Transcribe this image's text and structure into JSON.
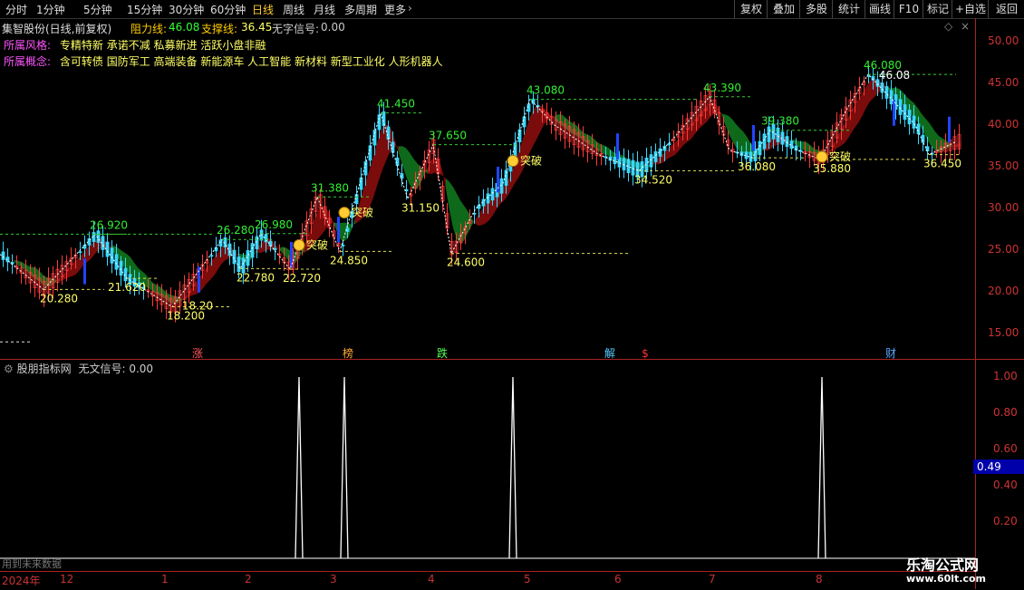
{
  "toolbar": {
    "timeframes": [
      "分时",
      "1分钟",
      "5分钟",
      "15分钟",
      "30分钟",
      "60分钟",
      "日线",
      "周线",
      "月线",
      "多周期",
      "更多"
    ],
    "active": "日线",
    "buttons": [
      "复权",
      "叠加",
      "多股",
      "统计",
      "画线",
      "F10",
      "标记",
      "+自选",
      "返回"
    ]
  },
  "header": {
    "stock": "集智股份(日线,前复权)",
    "resist_label": "阻力线:",
    "resist_value": "46.08",
    "support_label": "支撑线:",
    "support_value": "36.45",
    "signal_label": "无字信号:",
    "signal_value": "0.00"
  },
  "info": {
    "style_label": "所属风格:",
    "style_value": "专精特新 承诺不减 私募新进 活跃小盘非融",
    "concept_label": "所属概念:",
    "concept_value": "含可转债 国防军工 高端装备 新能源车 人工智能 新材料 新型工业化 人形机器人"
  },
  "main_axis": [
    "50.00",
    "45.00",
    "40.00",
    "35.00",
    "30.00",
    "25.00",
    "20.00",
    "15.00"
  ],
  "peaks": [
    {
      "label": "26.920"
    },
    {
      "label": "26.280"
    },
    {
      "label": "26.980"
    },
    {
      "label": "31.380"
    },
    {
      "label": "41.450"
    },
    {
      "label": "37.650"
    },
    {
      "label": "43.080"
    },
    {
      "label": "43.390"
    },
    {
      "label": "39.380"
    },
    {
      "label": "46.080"
    },
    {
      "label": "46.08"
    }
  ],
  "troughs": [
    {
      "label": "20.280"
    },
    {
      "label": "21.620"
    },
    {
      "label": "18.200"
    },
    {
      "label": "18.20"
    },
    {
      "label": "22.780"
    },
    {
      "label": "22.720"
    },
    {
      "label": "24.850"
    },
    {
      "label": "31.150"
    },
    {
      "label": "24.600"
    },
    {
      "label": "34.520"
    },
    {
      "label": "36.080"
    },
    {
      "label": "35.880"
    },
    {
      "label": "36.450"
    }
  ],
  "breakout_label": "突破",
  "bottom_marks": [
    {
      "text": "涨",
      "color": "#ff5555"
    },
    {
      "text": "榜",
      "color": "#ffaa33"
    },
    {
      "text": "跌",
      "color": "#55ff55"
    },
    {
      "text": "解",
      "color": "#55ccff"
    },
    {
      "text": "$",
      "color": "#ff3333"
    },
    {
      "text": "财",
      "color": "#55aaff"
    }
  ],
  "sub_panel": {
    "title": "股朋指标网",
    "signal_label": "无文信号:",
    "signal_value": "0.00",
    "axis": [
      "1.00",
      "0.80",
      "0.60",
      "0.40",
      "0.20"
    ],
    "current_value": "0.49",
    "note": "用到未来数据"
  },
  "date_axis": [
    "2024年",
    "12",
    "1",
    "2",
    "3",
    "4",
    "5",
    "6",
    "7",
    "8"
  ],
  "watermark": {
    "title": "乐淘公式网",
    "url": "www.60lt.com"
  }
}
